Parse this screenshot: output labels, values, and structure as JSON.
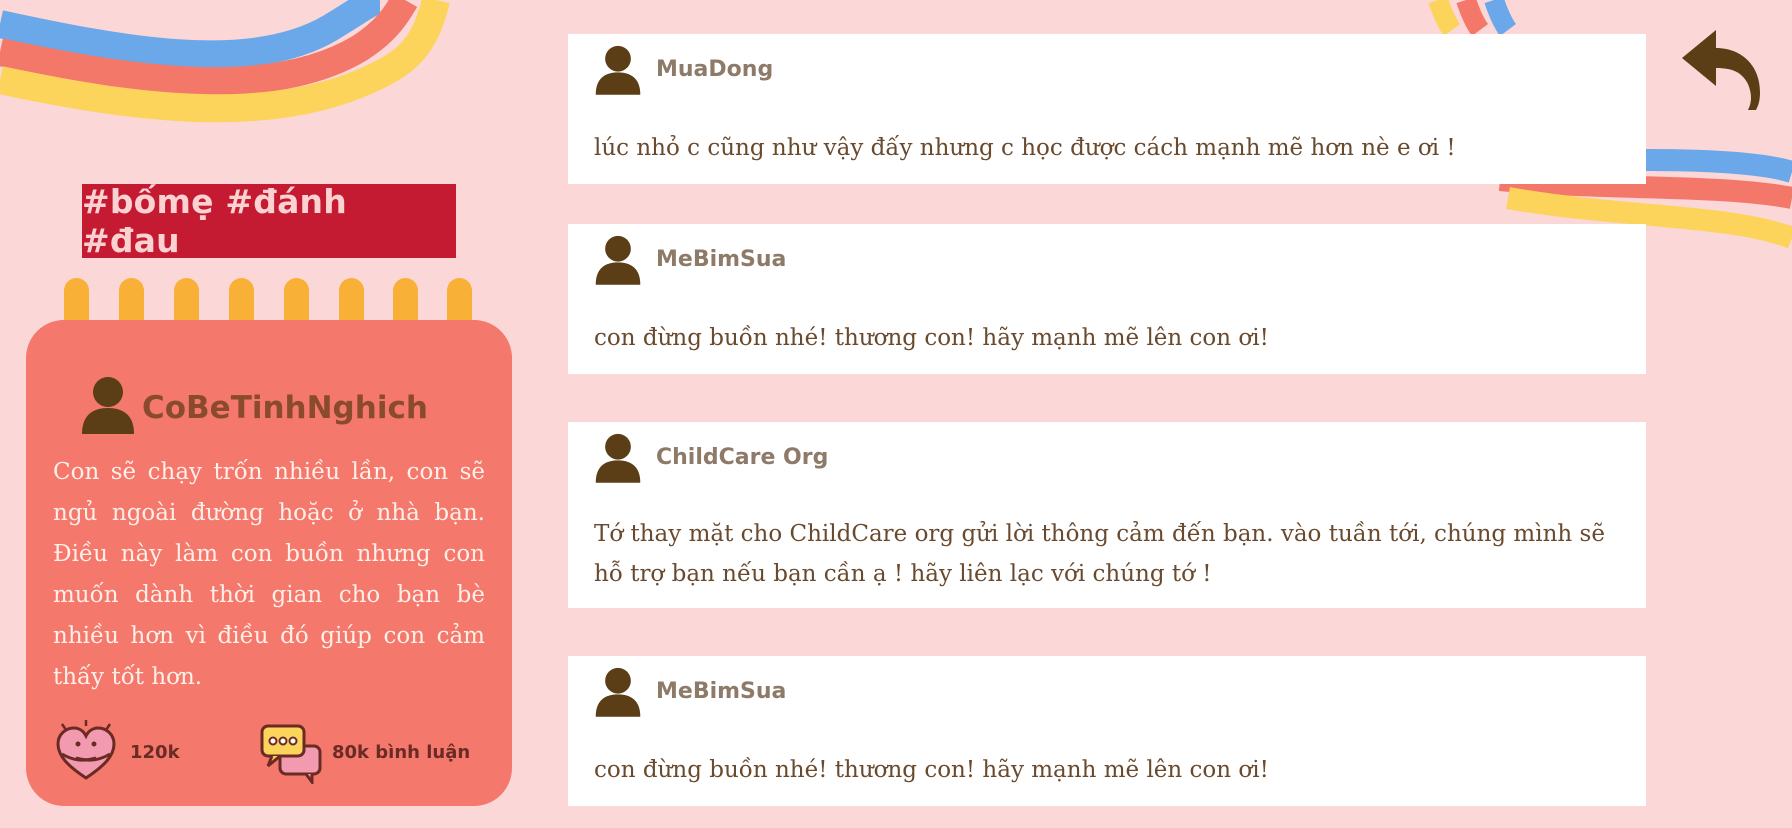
{
  "hashtag": "#bốmẹ #đánh #đau",
  "post": {
    "author": "CoBeTinhNghich",
    "content": "Con sẽ chạy trốn nhiều lần, con sẽ ngủ ngoài đường hoặc ở nhà bạn. Điều này làm con buồn nhưng con muốn dành thời gian cho bạn bè nhiều hơn vì điều đó giúp con cảm thấy tốt hơn.",
    "likes": "120k",
    "comments_label": "80k bình luận"
  },
  "comments": [
    {
      "user": "MuaDong",
      "text": "lúc nhỏ c cũng như vậy đấy nhưng c học được cách mạnh mẽ hơn nè e ơi !"
    },
    {
      "user": "MeBimSua",
      "text": "con đừng buồn nhé! thương con! hãy mạnh mẽ lên con ơi!"
    },
    {
      "user": "ChildCare Org",
      "text": "Tớ thay mặt cho ChildCare org gửi lời thông cảm đến bạn. vào tuần tới, chúng mình sẽ hỗ trợ bạn nếu bạn cần ạ ! hãy liên lạc với chúng tớ !"
    },
    {
      "user": "MeBimSua",
      "text": "con đừng buồn nhé! thương con! hãy mạnh mẽ lên con ơi!"
    }
  ],
  "colors": {
    "background": "#fbd7d7",
    "banner": "#c41b32",
    "card": "#f4786b",
    "spiral": "#f9b036",
    "avatar": "#5b3e16",
    "wave_blue": "#6aa8ea",
    "wave_red": "#f3786a",
    "wave_yellow": "#fcd45c",
    "back_arrow": "#5b3e16"
  },
  "icons": [
    "back-arrow-icon",
    "user-avatar-icon",
    "heart-hug-icon",
    "chat-bubbles-icon"
  ]
}
